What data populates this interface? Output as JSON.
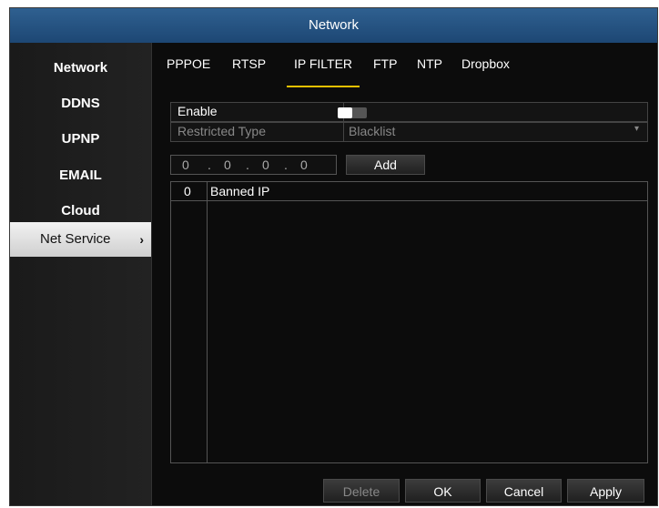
{
  "window": {
    "title": "Network"
  },
  "sidebar": {
    "items": [
      {
        "label": "Network"
      },
      {
        "label": "DDNS"
      },
      {
        "label": "UPNP"
      },
      {
        "label": "EMAIL"
      },
      {
        "label": "Cloud"
      },
      {
        "label": "Net Service",
        "active": true
      }
    ],
    "chevron": "›"
  },
  "tabs": [
    "PPPOE",
    "RTSP",
    "IP FILTER",
    "FTP",
    "NTP",
    "Dropbox"
  ],
  "active_tab": "IP FILTER",
  "form": {
    "enable_label": "Enable",
    "enable_value": true,
    "restricted_type_label": "Restricted Type",
    "restricted_type_value": "Blacklist"
  },
  "ip_input": {
    "octets": [
      "0",
      "0",
      "0",
      "0"
    ],
    "add_label": "Add"
  },
  "table": {
    "col_count_header": "0",
    "col_ip_header": "Banned IP",
    "rows": []
  },
  "footer": {
    "delete": "Delete",
    "ok": "OK",
    "cancel": "Cancel",
    "apply": "Apply"
  },
  "colors": {
    "accent": "#e8c000",
    "title_bar": "#285888"
  }
}
